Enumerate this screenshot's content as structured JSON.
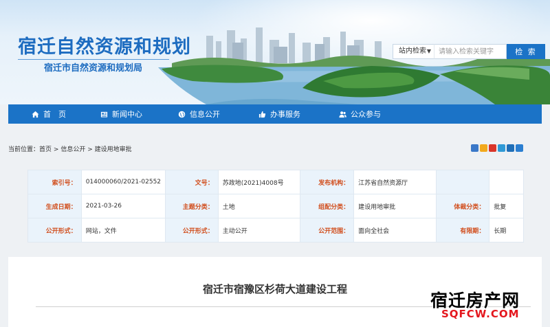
{
  "header": {
    "site_title": "宿迁自然资源和规划",
    "site_subtitle": "宿迁市自然资源和规划局"
  },
  "search": {
    "scope": "站内检索",
    "placeholder": "请输入检索关键字",
    "button_label": "检 索"
  },
  "nav": {
    "items": [
      {
        "label": "首　页",
        "icon": "home-icon"
      },
      {
        "label": "新闻中心",
        "icon": "newspaper-icon"
      },
      {
        "label": "信息公开",
        "icon": "globe-icon"
      },
      {
        "label": "办事服务",
        "icon": "thumbs-up-icon"
      },
      {
        "label": "公众参与",
        "icon": "users-icon"
      }
    ]
  },
  "breadcrumb": {
    "prefix": "当前位置：",
    "items": [
      "首页",
      "信息公开",
      "建设用地审批"
    ],
    "separator": " >"
  },
  "share_icons": [
    {
      "name": "share-plus-icon",
      "color": "#3a78c8"
    },
    {
      "name": "share-qzone-icon",
      "color": "#f2a91c"
    },
    {
      "name": "share-weibo-icon",
      "color": "#d9362a"
    },
    {
      "name": "share-tencent-icon",
      "color": "#2f9ad6"
    },
    {
      "name": "share-renren-icon",
      "color": "#1f6fb8"
    },
    {
      "name": "share-kaixin-icon",
      "color": "#2b7fd1"
    }
  ],
  "info": {
    "rows": [
      [
        {
          "label": "索引号：",
          "value": "014000060/2021-02552"
        },
        {
          "label": "文号：",
          "value": "苏政地(2021)4008号"
        },
        {
          "label": "发布机构：",
          "value": "江苏省自然资源厅"
        },
        {
          "label": "",
          "value": ""
        }
      ],
      [
        {
          "label": "生成日期：",
          "value": "2021-03-26"
        },
        {
          "label": "主题分类：",
          "value": "土地"
        },
        {
          "label": "组配分类：",
          "value": "建设用地审批"
        },
        {
          "label": "体裁分类：",
          "value": "批复"
        }
      ],
      [
        {
          "label": "公开形式：",
          "value": "网站，文件"
        },
        {
          "label": "公开形式：",
          "value": "主动公开"
        },
        {
          "label": "公开范围：",
          "value": "面向全社会"
        },
        {
          "label": "有限期：",
          "value": "长期"
        }
      ]
    ]
  },
  "article": {
    "title": "宿迁市宿豫区杉荷大道建设工程"
  },
  "watermark": {
    "main": "宿迁房产网",
    "sub": "SQFCW.COM"
  },
  "colors": {
    "brand_blue": "#1b73c7",
    "label_orange": "#d14e1d",
    "label_bg": "#eaf3fb",
    "watermark_red": "#e4161d"
  }
}
